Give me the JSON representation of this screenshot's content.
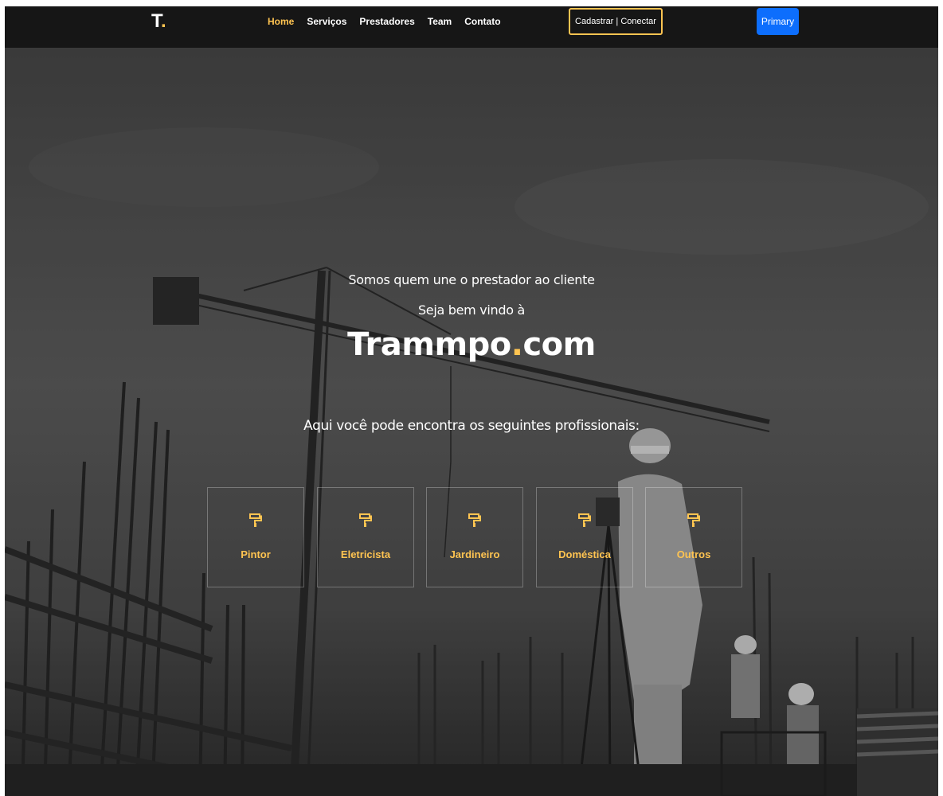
{
  "navbar": {
    "logo_letter": "T",
    "logo_dot": ".",
    "links": [
      {
        "label": "Home",
        "active": true
      },
      {
        "label": "Serviços",
        "active": false
      },
      {
        "label": "Prestadores",
        "active": false
      },
      {
        "label": "Team",
        "active": false
      },
      {
        "label": "Contato",
        "active": false
      }
    ],
    "cta_label": "Cadastrar | Conectar",
    "primary_label": "Primary"
  },
  "hero": {
    "tagline": "Somos quem une o prestador ao cliente",
    "welcome": "Seja bem vindo à",
    "brand_name": "Trammpo",
    "brand_dot": ".",
    "brand_tld": "com",
    "subtitle": "Aqui você pode encontra os seguintes profissionais:",
    "cards": [
      {
        "label": "Pintor",
        "icon": "paint-roller-icon"
      },
      {
        "label": "Eletricista",
        "icon": "paint-roller-icon"
      },
      {
        "label": "Jardineiro",
        "icon": "paint-roller-icon"
      },
      {
        "label": "Doméstica",
        "icon": "paint-roller-icon"
      },
      {
        "label": "Outros",
        "icon": "paint-roller-icon"
      }
    ]
  },
  "colors": {
    "accent": "#ffc451",
    "navbar_bg": "#161616",
    "primary_button": "#0d6efd"
  }
}
